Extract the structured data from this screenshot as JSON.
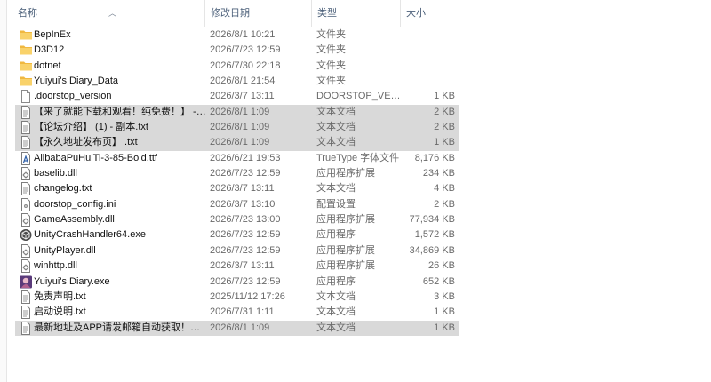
{
  "columns": {
    "name": "名称",
    "date": "修改日期",
    "type": "类型",
    "size": "大小"
  },
  "files": [
    {
      "name": "BepInEx",
      "date": "2026/8/1 10:21",
      "type": "文件夹",
      "size": "",
      "icon": "folder-icon",
      "selected": false
    },
    {
      "name": "D3D12",
      "date": "2026/7/23 12:59",
      "type": "文件夹",
      "size": "",
      "icon": "folder-icon",
      "selected": false
    },
    {
      "name": "dotnet",
      "date": "2026/7/30 22:18",
      "type": "文件夹",
      "size": "",
      "icon": "folder-icon",
      "selected": false
    },
    {
      "name": "Yuiyui's Diary_Data",
      "date": "2026/8/1 21:54",
      "type": "文件夹",
      "size": "",
      "icon": "folder-icon",
      "selected": false
    },
    {
      "name": ".doorstop_version",
      "date": "2026/3/7 13:11",
      "type": "DOORSTOP_VER...",
      "size": "1 KB",
      "icon": "blank-file-icon",
      "selected": false
    },
    {
      "name": "【来了就能下载和观看！纯免费！】 - 副...",
      "date": "2026/8/1 1:09",
      "type": "文本文档",
      "size": "2 KB",
      "icon": "text-file-icon",
      "selected": true
    },
    {
      "name": "【论坛介绍】 (1) - 副本.txt",
      "date": "2026/8/1 1:09",
      "type": "文本文档",
      "size": "2 KB",
      "icon": "text-file-icon",
      "selected": true
    },
    {
      "name": "【永久地址发布页】 .txt",
      "date": "2026/8/1 1:09",
      "type": "文本文档",
      "size": "1 KB",
      "icon": "text-file-icon",
      "selected": true
    },
    {
      "name": "AlibabaPuHuiTi-3-85-Bold.ttf",
      "date": "2026/6/21 19:53",
      "type": "TrueType 字体文件",
      "size": "8,176 KB",
      "icon": "font-file-icon",
      "selected": false
    },
    {
      "name": "baselib.dll",
      "date": "2026/7/23 12:59",
      "type": "应用程序扩展",
      "size": "234 KB",
      "icon": "dll-file-icon",
      "selected": false
    },
    {
      "name": "changelog.txt",
      "date": "2026/3/7 13:11",
      "type": "文本文档",
      "size": "4 KB",
      "icon": "text-file-icon",
      "selected": false
    },
    {
      "name": "doorstop_config.ini",
      "date": "2026/3/7 13:10",
      "type": "配置设置",
      "size": "2 KB",
      "icon": "config-file-icon",
      "selected": false
    },
    {
      "name": "GameAssembly.dll",
      "date": "2026/7/23 13:00",
      "type": "应用程序扩展",
      "size": "77,934 KB",
      "icon": "dll-file-icon",
      "selected": false
    },
    {
      "name": "UnityCrashHandler64.exe",
      "date": "2026/7/23 12:59",
      "type": "应用程序",
      "size": "1,572 KB",
      "icon": "unity-app-icon",
      "selected": false
    },
    {
      "name": "UnityPlayer.dll",
      "date": "2026/7/23 12:59",
      "type": "应用程序扩展",
      "size": "34,869 KB",
      "icon": "dll-file-icon",
      "selected": false
    },
    {
      "name": "winhttp.dll",
      "date": "2026/3/7 13:11",
      "type": "应用程序扩展",
      "size": "26 KB",
      "icon": "dll-file-icon",
      "selected": false
    },
    {
      "name": "Yuiyui's Diary.exe",
      "date": "2026/7/23 12:59",
      "type": "应用程序",
      "size": "652 KB",
      "icon": "game-app-icon",
      "selected": false
    },
    {
      "name": "免责声明.txt",
      "date": "2025/11/12 17:26",
      "type": "文本文档",
      "size": "3 KB",
      "icon": "text-file-icon",
      "selected": false
    },
    {
      "name": "启动说明.txt",
      "date": "2026/7/31 1:11",
      "type": "文本文档",
      "size": "1 KB",
      "icon": "text-file-icon",
      "selected": false
    },
    {
      "name": "最新地址及APP请发邮箱自动获取！！！...",
      "date": "2026/8/1 1:09",
      "type": "文本文档",
      "size": "1 KB",
      "icon": "text-file-icon",
      "selected": true
    }
  ],
  "colors": {
    "folder": "#f7c751",
    "selection": "#d9d9d9",
    "header_text": "#4c607a"
  }
}
